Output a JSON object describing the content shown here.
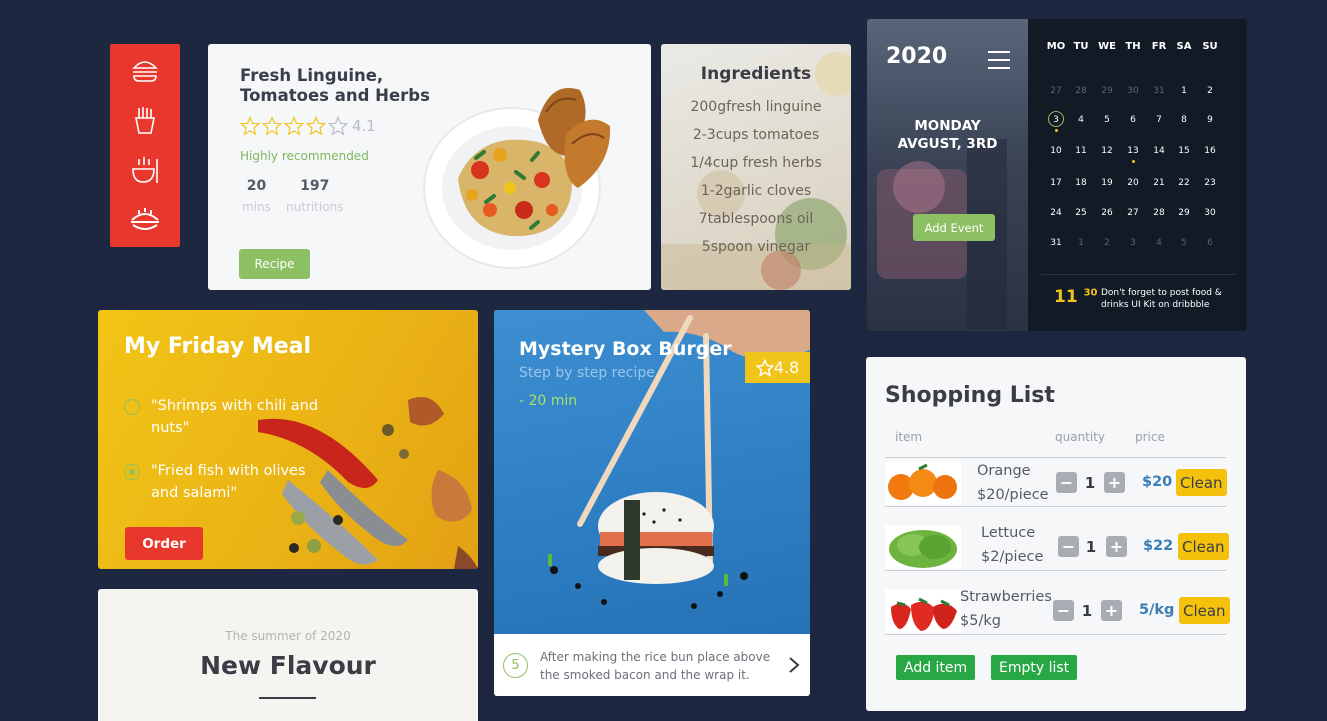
{
  "sidebar": {
    "icons": [
      "burger-icon",
      "fries-icon",
      "bowl-icon",
      "pie-icon"
    ],
    "color": "#e8372d"
  },
  "recipe": {
    "title": "Fresh Linguine, Tomatoes and Herbs",
    "rating": "4.1",
    "stars_filled": 0,
    "stars_total": 5,
    "recommendation": "Highly recommended",
    "stats": [
      {
        "value": "20",
        "label": "mins"
      },
      {
        "value": "197",
        "label": "nutritions"
      }
    ],
    "button_label": "Recipe"
  },
  "ingredients": {
    "title": "Ingredients",
    "items": [
      "200gfresh linguine",
      "2-3cups tomatoes",
      "1/4cup fresh herbs",
      "1-2garlic cloves",
      "7tablespoons oil",
      "5spoon vinegar"
    ]
  },
  "calendar": {
    "year": "2020",
    "day_line1": "MONDAY",
    "day_line2": "AVGUST, 3RD",
    "add_event_label": "Add Event",
    "weekdays": [
      "MO",
      "TU",
      "WE",
      "TH",
      "FR",
      "SA",
      "SU"
    ],
    "weeks": [
      [
        "27",
        "28",
        "29",
        "30",
        "31",
        "1",
        "2"
      ],
      [
        "3",
        "4",
        "5",
        "6",
        "7",
        "8",
        "9"
      ],
      [
        "10",
        "11",
        "12",
        "13",
        "14",
        "15",
        "16"
      ],
      [
        "17",
        "18",
        "19",
        "20",
        "21",
        "22",
        "23"
      ],
      [
        "24",
        "25",
        "26",
        "27",
        "28",
        "29",
        "30"
      ],
      [
        "31",
        "1",
        "2",
        "3",
        "4",
        "5",
        "6"
      ]
    ],
    "reminder_hour": "11",
    "reminder_minute": "30",
    "reminder_text": "Don't forget to post food & drinks UI Kit on dribbble"
  },
  "friday": {
    "title": "My Friday Meal",
    "items": [
      {
        "text": "\"Shrimps with chili and nuts\"",
        "selected": false
      },
      {
        "text": "\"Fried fish with olives and salami\"",
        "selected": true
      }
    ],
    "button_label": "Order"
  },
  "burger": {
    "title": "Mystery Box Burger",
    "subtitle": "Step by step recipe",
    "time": "- 20 min",
    "rating": "4.8",
    "step_number": "5",
    "step_text": "After making the rice bun place above the smoked bacon and the wrap it."
  },
  "flavour": {
    "pretitle": "The summer of 2020",
    "title": "New Flavour"
  },
  "shopping": {
    "title": "Shopping List",
    "headers": {
      "item": "item",
      "quantity": "quantity",
      "price": "price"
    },
    "rows": [
      {
        "name": "Orange",
        "unit": "$20/piece",
        "qty": "1",
        "price": "$20",
        "clean": "Clean"
      },
      {
        "name": "Lettuce",
        "unit": "$2/piece",
        "qty": "1",
        "price": "$22",
        "clean": "Clean"
      },
      {
        "name": "Strawberries",
        "unit": "$5/kg",
        "qty": "1",
        "price": "5/kg",
        "clean": "Clean"
      }
    ],
    "add_label": "Add item",
    "empty_label": "Empty list"
  }
}
